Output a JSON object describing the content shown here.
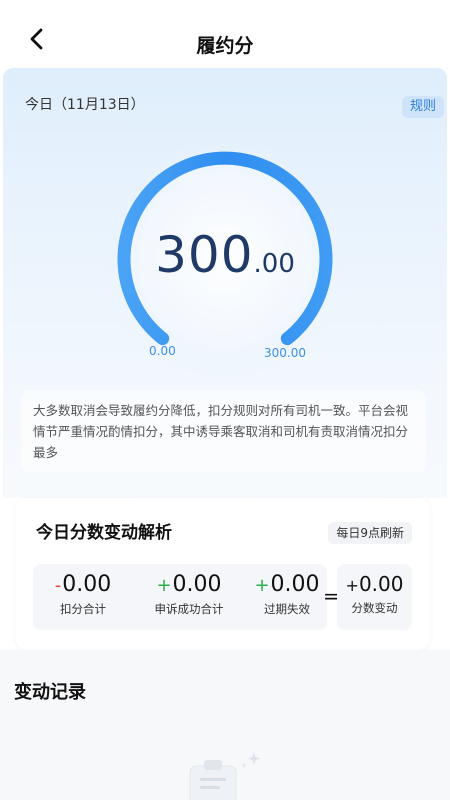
{
  "header": {
    "title": "履约分",
    "back_icon": "chevron-left-icon"
  },
  "hero": {
    "date": "今日（11月13日）",
    "rules_label": "规则",
    "score_int": "300",
    "score_dec": ".00",
    "gauge_min": "0.00",
    "gauge_max": "300.00",
    "gauge_fraction": 1.0,
    "notice": "大多数取消会导致履约分降低，扣分规则对所有司机一致。平台会视情节严重情况酌情扣分，其中诱导乘客取消和司机有责取消情况扣分最多"
  },
  "analysis": {
    "title": "今日分数变动解析",
    "refresh": "每日9点刷新",
    "stats": [
      {
        "sign": "-",
        "value": "0.00",
        "label": "扣分合计"
      },
      {
        "sign": "+",
        "value": "0.00",
        "label": "申诉成功合计"
      },
      {
        "sign": "+",
        "value": "0.00",
        "label": "过期失效"
      }
    ],
    "equals": "=",
    "result": {
      "sign": "+",
      "value": "0.00",
      "label": "分数变动"
    }
  },
  "records": {
    "title": "变动记录"
  },
  "colors": {
    "accent": "#2f8ef0",
    "minus": "#e0463a",
    "plus": "#2ab04c"
  }
}
